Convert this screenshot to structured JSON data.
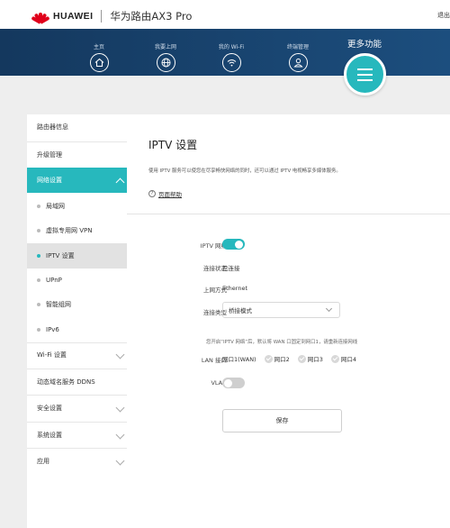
{
  "header": {
    "brand": "HUAWEI",
    "product": "华为路由AX3 Pro",
    "logout": "退出"
  },
  "nav": {
    "items": [
      {
        "label": "主页",
        "icon": "home-icon"
      },
      {
        "label": "我要上网",
        "icon": "globe-icon"
      },
      {
        "label": "我的 Wi-Fi",
        "icon": "wifi-icon"
      },
      {
        "label": "终端管理",
        "icon": "user-icon"
      }
    ],
    "more_label": "更多功能",
    "more_icon": "menu-icon"
  },
  "sidebar": {
    "items": [
      {
        "label": "路由器信息"
      },
      {
        "label": "升级管理"
      },
      {
        "label": "网络设置"
      },
      {
        "label": "局域网"
      },
      {
        "label": "虚拟专用网 VPN"
      },
      {
        "label": "IPTV 设置"
      },
      {
        "label": "UPnP"
      },
      {
        "label": "智能组网"
      },
      {
        "label": "IPv6"
      },
      {
        "label": "Wi-Fi 设置"
      },
      {
        "label": "动态域名服务 DDNS"
      },
      {
        "label": "安全设置"
      },
      {
        "label": "系统设置"
      },
      {
        "label": "应用"
      }
    ]
  },
  "main": {
    "title": "IPTV 设置",
    "description": "使用 IPTV 服务可以使您在尽享畅快网络的同时，还可以通过 IPTV 电视畅享多媒体服务。",
    "help_label": "页面帮助",
    "iptv_label": "IPTV 网络",
    "iptv_enabled": true,
    "status_label": "连接状态",
    "status_value": "已连接",
    "access_label": "上网方式",
    "access_value": "Ethernet",
    "type_label": "连接类型",
    "type_value": "桥接模式",
    "note": "您开启“IPTV 网络”后，默认将 WAN 口固定到网口1，请重新连接网线",
    "lan_label": "LAN 接口",
    "ports": [
      "网口1(WAN)",
      "网口2",
      "网口3",
      "网口4"
    ],
    "vlan_label": "VLAN",
    "vlan_enabled": false,
    "save_label": "保存"
  },
  "colors": {
    "accent": "#27b8bd",
    "nav_bg": "#1a4a78",
    "brand_red": "#e0001b"
  }
}
